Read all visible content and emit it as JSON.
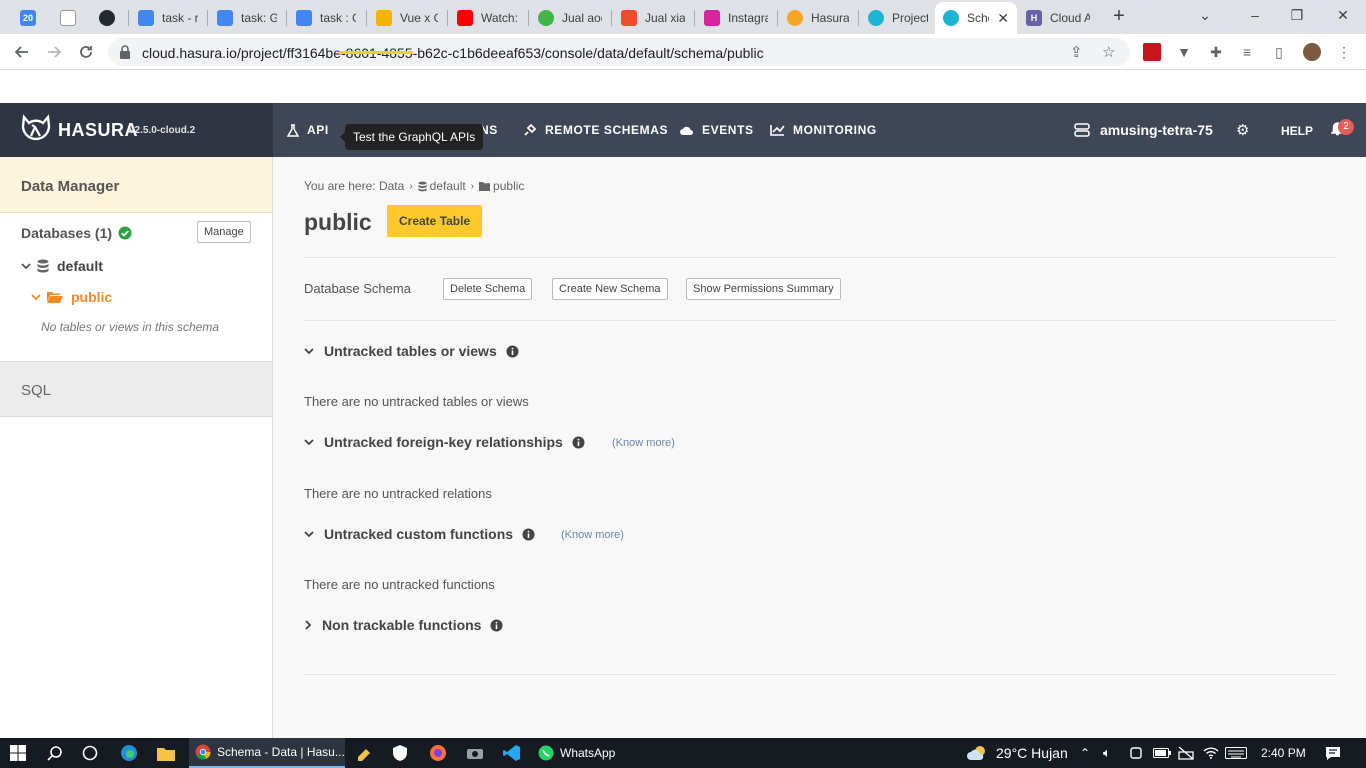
{
  "browser": {
    "tabs": [
      {
        "title": "",
        "icon": "calendar-icon",
        "color": "#4285f4",
        "glyph": "20"
      },
      {
        "title": "",
        "icon": "graph-icon",
        "color": "#ffffff",
        "glyph": ""
      },
      {
        "title": "",
        "icon": "github-icon",
        "color": "#24292f",
        "glyph": ""
      },
      {
        "title": "task - re",
        "icon": "docs-icon",
        "color": "#4285f4",
        "glyph": ""
      },
      {
        "title": "task: Gr",
        "icon": "docs-icon",
        "color": "#4285f4",
        "glyph": ""
      },
      {
        "title": "task : G",
        "icon": "docs-icon",
        "color": "#4285f4",
        "glyph": ""
      },
      {
        "title": "Vue x G",
        "icon": "slides-icon",
        "color": "#f4b400",
        "glyph": ""
      },
      {
        "title": "Watch:",
        "icon": "youtube-icon",
        "color": "#ff0000",
        "glyph": ""
      },
      {
        "title": "Jual aoc",
        "icon": "tokopedia-icon",
        "color": "#42b549",
        "glyph": ""
      },
      {
        "title": "Jual xiac",
        "icon": "shopee-icon",
        "color": "#ee4d2d",
        "glyph": ""
      },
      {
        "title": "Instagra",
        "icon": "instagram-icon",
        "color": "#d6249f",
        "glyph": ""
      },
      {
        "title": "Hasura",
        "icon": "hasura-icon",
        "color": "#f5a623",
        "glyph": ""
      },
      {
        "title": "Projects",
        "icon": "hasura-icon",
        "color": "#1eb4d4",
        "glyph": ""
      },
      {
        "title": "Sche",
        "icon": "hasura-icon",
        "color": "#1eb4d4",
        "glyph": "",
        "active": true
      },
      {
        "title": "Cloud A",
        "icon": "heroku-icon",
        "color": "#6762a6",
        "glyph": "H"
      }
    ],
    "url": "cloud.hasura.io/project/ff3164be-8601-4855-b62c-c1b6deeaf653/console/data/default/schema/public"
  },
  "header": {
    "brand": "HASURA",
    "version": "v2.5.0-cloud.2",
    "nav": {
      "api": "API",
      "actions_tail": "NS",
      "remote_schemas": "REMOTE SCHEMAS",
      "events": "EVENTS",
      "monitoring": "MONITORING"
    },
    "tooltip": "Test the GraphQL APIs",
    "project_name": "amusing-tetra-75",
    "help": "HELP",
    "notification_count": "2"
  },
  "sidebar": {
    "title": "Data Manager",
    "databases_label": "Databases (1)",
    "manage_label": "Manage",
    "database": "default",
    "schema": "public",
    "empty_note": "No tables or views in this schema",
    "sql_label": "SQL"
  },
  "main": {
    "breadcrumb": {
      "prefix": "You are here:",
      "data": "Data",
      "database": "default",
      "schema": "public"
    },
    "title": "public",
    "create_table": "Create Table",
    "schema_label": "Database Schema",
    "delete_schema": "Delete Schema",
    "create_schema": "Create New Schema",
    "permissions_summary": "Show Permissions Summary",
    "sections": [
      {
        "title": "Untracked tables or views",
        "message": "There are no untracked tables or views",
        "know_more": "",
        "expanded": true
      },
      {
        "title": "Untracked foreign-key relationships",
        "message": "There are no untracked relations",
        "know_more": "(Know more)",
        "expanded": true
      },
      {
        "title": "Untracked custom functions",
        "message": "There are no untracked functions",
        "know_more": "(Know more)",
        "expanded": true
      },
      {
        "title": "Non trackable functions",
        "message": "",
        "know_more": "",
        "expanded": false
      }
    ]
  },
  "taskbar": {
    "active_window": "Schema - Data | Hasu...",
    "whatsapp": "WhatsApp",
    "weather": "29°C  Hujan",
    "time": "2:40 PM"
  },
  "colors": {
    "accent": "#ffc82c",
    "header_bg": "#3f4757",
    "brand_bg": "#2f3542",
    "active_schema": "#f28a2b",
    "success": "#2ea043"
  }
}
